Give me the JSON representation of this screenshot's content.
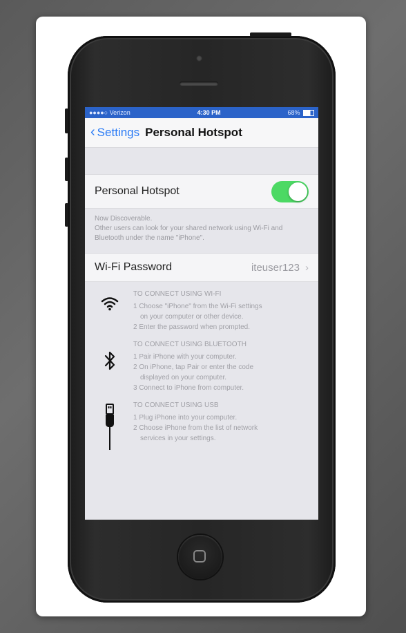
{
  "status_bar": {
    "carrier": "●●●●○ Verizon",
    "time": "4:30 PM",
    "battery": "68%"
  },
  "nav": {
    "back_label": "Settings",
    "title": "Personal Hotspot"
  },
  "hotspot": {
    "label": "Personal Hotspot",
    "enabled": true,
    "discoverable": "Now Discoverable.",
    "description": "Other users can look for your shared network using Wi-Fi and Bluetooth under the name \"iPhone\"."
  },
  "wifi_password": {
    "label": "Wi-Fi Password",
    "value": "iteuser123"
  },
  "instructions": {
    "wifi": {
      "icon": "wifi-icon",
      "head": "TO CONNECT USING WI-FI",
      "step1": "1 Choose \"iPhone\" from the Wi-Fi settings",
      "step1b": "on your computer or other device.",
      "step2": "2 Enter the password when prompted."
    },
    "bluetooth": {
      "icon": "bluetooth-icon",
      "head": "TO CONNECT USING BLUETOOTH",
      "step1": "1 Pair iPhone with your computer.",
      "step2": "2 On iPhone, tap Pair or enter the code",
      "step2b": "displayed on your computer.",
      "step3": "3 Connect to iPhone from computer."
    },
    "usb": {
      "icon": "usb-cable-icon",
      "head": "TO CONNECT USING USB",
      "step1": "1 Plug iPhone into your computer.",
      "step2": "2 Choose iPhone from the list of network",
      "step2b": "services in your settings."
    }
  },
  "colors": {
    "accent": "#2a7bf5",
    "toggle_on": "#4cd964",
    "status_bar": "#2b63c9"
  }
}
